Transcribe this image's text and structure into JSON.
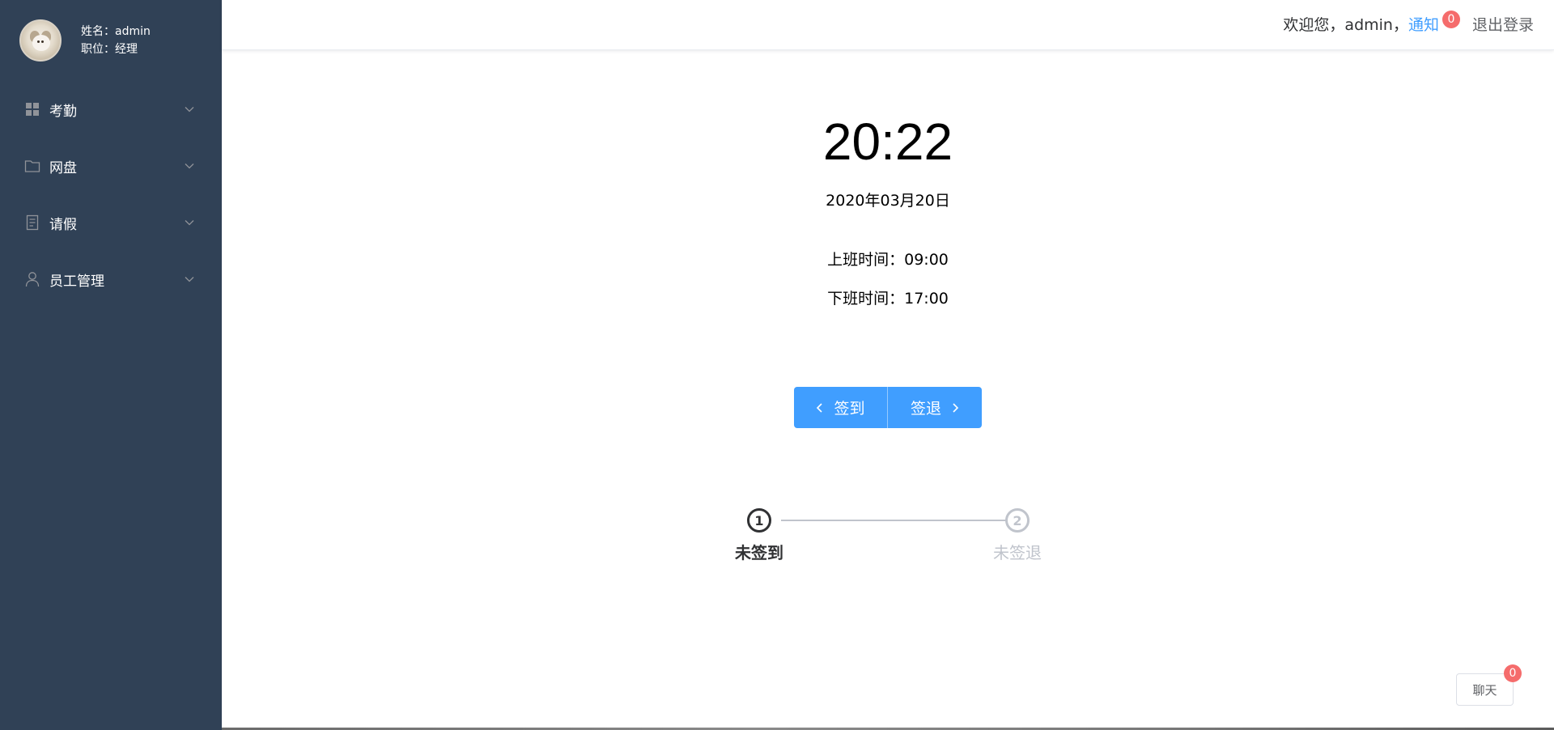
{
  "profile": {
    "name_line": "姓名：admin",
    "position_line": "职位：经理"
  },
  "sidebar": {
    "items": [
      {
        "label": "考勤",
        "icon": "grid-icon"
      },
      {
        "label": "网盘",
        "icon": "folder-icon"
      },
      {
        "label": "请假",
        "icon": "document-icon"
      },
      {
        "label": "员工管理",
        "icon": "user-icon"
      }
    ]
  },
  "header": {
    "welcome": "欢迎您，admin，",
    "notify_label": "通知",
    "notify_count": "0",
    "logout_label": "退出登录"
  },
  "main": {
    "clock": "20:22",
    "date": "2020年03月20日",
    "work_start": "上班时间：09:00",
    "work_end": "下班时间：17:00",
    "checkin_label": "签到",
    "checkout_label": "签退"
  },
  "steps": [
    {
      "number": "1",
      "title": "未签到",
      "active": true
    },
    {
      "number": "2",
      "title": "未签退",
      "active": false
    }
  ],
  "chat": {
    "label": "聊天",
    "count": "0"
  },
  "colors": {
    "sidebar_bg": "#304156",
    "primary": "#409eff",
    "badge": "#f56c6c",
    "inactive": "#c0c4cc"
  }
}
